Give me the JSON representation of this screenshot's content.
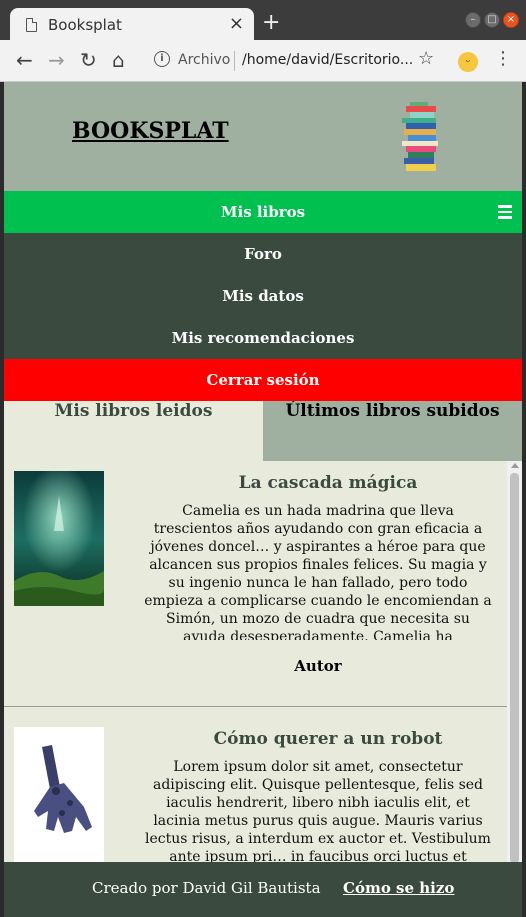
{
  "browser": {
    "tab_title": "Booksplat",
    "tab_close": "×",
    "new_tab": "+",
    "scheme_label": "Archivo",
    "url": "/home/david/Escritorio...",
    "min": "–",
    "max": "□",
    "close": "×"
  },
  "header": {
    "brand": "BOOKSPLAT"
  },
  "nav": {
    "items": [
      {
        "label": "Mis libros"
      },
      {
        "label": "Foro"
      },
      {
        "label": "Mis datos"
      },
      {
        "label": "Mis recomendaciones"
      },
      {
        "label": "Cerrar sesión"
      }
    ]
  },
  "tabs": {
    "left": "Mis libros leidos",
    "right": "Últimos libros subidos"
  },
  "books": [
    {
      "title": "La cascada mágica",
      "description": "Camelia es un hada madrina que lleva trescientos años ayudando con gran eficacia a jóvenes doncel… y aspirantes a héroe para que alcancen sus propios finales felices. Su magia y su ingenio nunca le han fallado, pero todo empieza a complicarse cuando le encomiendan a Simón, un mozo de cuadra que necesita su ayuda desesperadamente. Camelia ha solucionado casos más difíciles; pero, por algún",
      "author": "Autor"
    },
    {
      "title": "Cómo querer a un robot",
      "description": "Lorem ipsum dolor sit amet, consectetur adipiscing elit. Quisque pellentesque, felis sed iaculis hendrerit, libero nibh iaculis elit, et lacinia metus purus quis augue. Mauris varius lectus risus, a interdum ex auctor et. Vestibulum ante ipsum pri… in faucibus orci luctus et ultrices posuere cubilia"
    }
  ],
  "footer": {
    "credit": "Creado por David Gil Bautista",
    "link": "Cómo se hizo"
  },
  "colors": {
    "header_bg": "#9fb0a0",
    "nav_active": "#00c050",
    "nav_dark": "#3a4a3f",
    "logout": "#ff0000",
    "content_bg": "#e8ebdb"
  }
}
